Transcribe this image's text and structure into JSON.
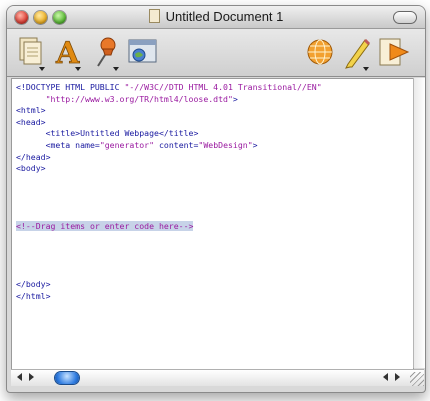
{
  "window": {
    "title": "Untitled Document 1"
  },
  "toolbar": {
    "buttons": [
      {
        "name": "insert-text-button",
        "icon": "document-stack-icon",
        "has_menu": true
      },
      {
        "name": "font-button",
        "icon": "letter-a-icon",
        "has_menu": true
      },
      {
        "name": "pin-button",
        "icon": "pushpin-icon",
        "has_menu": true
      },
      {
        "name": "web-preview-button",
        "icon": "browser-window-icon",
        "has_menu": false
      },
      {
        "name": "globe-button",
        "icon": "globe-icon",
        "has_menu": false
      },
      {
        "name": "edit-button",
        "icon": "pencil-icon",
        "has_menu": true
      },
      {
        "name": "preview-button",
        "icon": "play-icon",
        "has_menu": false
      }
    ]
  },
  "editor": {
    "lines": [
      [
        {
          "text": "<!DOCTYPE HTML PUBLIC ",
          "c": "t"
        },
        {
          "text": "\"-//W3C//DTD HTML 4.01 Transitional//EN\"",
          "c": "s"
        }
      ],
      [
        {
          "text": "      ",
          "c": "t"
        },
        {
          "text": "\"http://www.w3.org/TR/html4/loose.dtd\"",
          "c": "s"
        },
        {
          "text": ">",
          "c": "t"
        }
      ],
      [
        {
          "text": "<html>",
          "c": "t"
        }
      ],
      [
        {
          "text": "<head>",
          "c": "t"
        }
      ],
      [
        {
          "text": "      <title>Untitled Webpage</title>",
          "c": "t"
        }
      ],
      [
        {
          "text": "      <meta name=",
          "c": "t"
        },
        {
          "text": "\"generator\"",
          "c": "s"
        },
        {
          "text": " content=",
          "c": "t"
        },
        {
          "text": "\"WebDesign\"",
          "c": "s"
        },
        {
          "text": ">",
          "c": "t"
        }
      ],
      [
        {
          "text": "</head>",
          "c": "t"
        }
      ],
      [
        {
          "text": "<body>",
          "c": "t"
        }
      ],
      [],
      [],
      [],
      [],
      [
        {
          "text": "<!--Drag items or enter code here-->",
          "c": "c",
          "hl": true
        }
      ],
      [],
      [],
      [],
      [],
      [
        {
          "text": "</body>",
          "c": "t"
        }
      ],
      [
        {
          "text": "</html>",
          "c": "t"
        }
      ]
    ]
  },
  "colors": {
    "tag": "#1a1aa0",
    "string": "#9a1aa0",
    "selection": "#c7d3e8"
  }
}
